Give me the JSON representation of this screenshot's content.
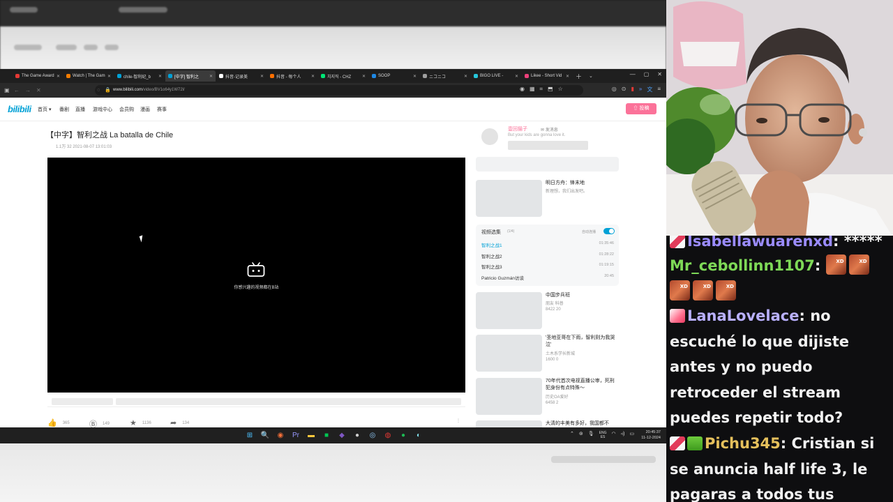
{
  "browser": {
    "tabs": [
      {
        "label": "The Game Award",
        "color": "#e53935",
        "active": false
      },
      {
        "label": "Watch | The Gam",
        "color": "#f57c00",
        "active": false
      },
      {
        "label": "chile-智利纪_b",
        "color": "#00a1d6",
        "active": false
      },
      {
        "label": "[中字] 智利之",
        "color": "#00a1d6",
        "active": true
      },
      {
        "label": "抖音-记录美",
        "color": "#ffffff",
        "active": false
      },
      {
        "label": "抖音 - 每个人",
        "color": "#ff6f00",
        "active": false
      },
      {
        "label": "치지직 - CHZ",
        "color": "#00e676",
        "active": false
      },
      {
        "label": "SOOP",
        "color": "#1e88e5",
        "active": false
      },
      {
        "label": "ニコニコ",
        "color": "#9e9e9e",
        "active": false
      },
      {
        "label": "BIGO LIVE -",
        "color": "#26c6da",
        "active": false
      },
      {
        "label": "Likee - Short Vid",
        "color": "#ec407a",
        "active": false
      }
    ],
    "url_host": "www.bilibili.com",
    "url_path": "/video/BV1o64y1W72l/"
  },
  "site": {
    "logo": "bilibili",
    "nav": [
      "首页 ▾",
      "番剧",
      "直播",
      "游戏中心",
      "会员购",
      "漫画",
      "赛事"
    ],
    "upload_label": "⇧ 投稿"
  },
  "video": {
    "title": "【中字】智利之战 La batalla de Chile",
    "meta": "1.1万    32   2021-08-07 13:01:03",
    "player_message": "你感兴趣的视频都在B站",
    "actions": [
      {
        "icon": "👍",
        "value": "365"
      },
      {
        "icon": "Ⓑ",
        "value": "149"
      },
      {
        "icon": "★",
        "value": "1136"
      },
      {
        "icon": "➦",
        "value": "134"
      }
    ]
  },
  "uploader": {
    "name": "壹回猫子",
    "message_label": "✉ 发消息",
    "signature": "But your kids are gonna love it."
  },
  "recommendations": [
    {
      "title": "明日方舟：锋末地",
      "line2": "新理想，我们出发吧。",
      "stats": ""
    },
    {
      "title": "中国步兵班",
      "line2": "朋友 科普",
      "stats": "8422     20"
    },
    {
      "title": "'圣地亚哥在下雨，智利则为我哭泣'",
      "line2": "土木系学长新城",
      "stats": "1600     0"
    },
    {
      "title": "70年代首次电视直播公审，死刑犯身份有点特殊～",
      "line2": "历史OA爱好",
      "stats": "6458     2"
    },
    {
      "title": "大清的丰美有多好，我国都不",
      "line2": "",
      "stats": ""
    }
  ],
  "playlist": {
    "title": "视频选集",
    "count": "(1/4)",
    "autoplay_label": "自动连播",
    "autoplay_on": true,
    "items": [
      {
        "label": "智利之战1",
        "duration": "01:35:46",
        "current": true
      },
      {
        "label": "智利之战2",
        "duration": "01:28:22",
        "current": false
      },
      {
        "label": "智利之战3",
        "duration": "01:19:15",
        "current": false
      },
      {
        "label": "Patricio Guzmán访谈",
        "duration": "20:45",
        "current": false
      }
    ]
  },
  "taskbar": {
    "icons": [
      {
        "name": "windows-start-icon",
        "glyph": "⊞",
        "color": "#4cc2ff"
      },
      {
        "name": "search-icon",
        "glyph": "🔍",
        "color": "#ff9800"
      },
      {
        "name": "firefox-icon",
        "glyph": "◉",
        "color": "#ff7139"
      },
      {
        "name": "premiere-icon",
        "glyph": "Pr",
        "color": "#9999ff"
      },
      {
        "name": "file-explorer-icon",
        "glyph": "▬",
        "color": "#ffc83d"
      },
      {
        "name": "chat-app-icon",
        "glyph": "■",
        "color": "#00c853"
      },
      {
        "name": "discord-icon",
        "glyph": "◆",
        "color": "#7e57c2"
      },
      {
        "name": "obs-icon",
        "glyph": "●",
        "color": "#cfcfcf"
      },
      {
        "name": "steam-icon",
        "glyph": "◎",
        "color": "#90caf9"
      },
      {
        "name": "chrome-icon",
        "glyph": "◍",
        "color": "#e53935"
      },
      {
        "name": "spotify-icon",
        "glyph": "●",
        "color": "#1db954"
      },
      {
        "name": "globe-icon",
        "glyph": "◐",
        "color": "#80deea"
      }
    ],
    "lang": "ENG",
    "lang_sub": "ES",
    "time": "20:45:37",
    "date": "11-12-2024"
  },
  "chat": {
    "messages": [
      {
        "user": "Isabellawuarenxd",
        "user_color": "#9b8cff",
        "badges": [
          "sword"
        ],
        "text": " *****",
        "emotes": 0
      },
      {
        "user": "Mr_cebollinn1107",
        "user_color": "#7ed957",
        "badges": [],
        "text": " ",
        "emotes": 5
      },
      {
        "user": "LanaLovelace",
        "user_color": "#b9b0ff",
        "badges": [
          "gem"
        ],
        "text": " no escuché lo que dijiste antes y no puedo retroceder el stream puedes repetir todo?",
        "emotes": 0
      },
      {
        "user": "Pichu345",
        "user_color": "#e5c05c",
        "badges": [
          "sword",
          "1st"
        ],
        "text": " Cristian si se anuncia half life 3, le pagaras a todos tus",
        "emotes": 0
      }
    ]
  }
}
